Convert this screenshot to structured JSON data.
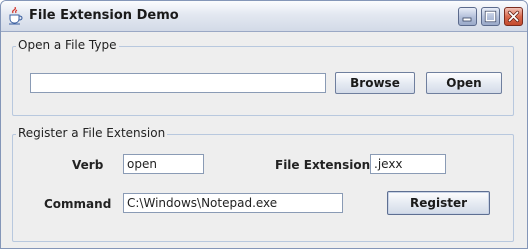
{
  "window": {
    "title": "File Extension Demo",
    "icon": "java-cup-icon",
    "controls": [
      "minimize-icon",
      "maximize-icon",
      "close-icon"
    ]
  },
  "open_group": {
    "title": "Open a File Type",
    "path_value": "",
    "browse_label": "Browse",
    "open_label": "Open"
  },
  "register_group": {
    "title": "Register a File Extension",
    "verb_label": "Verb",
    "verb_value": "open",
    "extension_label": "File Extension",
    "extension_value": ".jexx",
    "command_label": "Command",
    "command_value": "C:\\Windows\\Notepad.exe",
    "register_label": "Register"
  },
  "colors": {
    "window_bg": "#eeeeee",
    "group_border": "#b8c8de",
    "close_button": "#c44a2d"
  }
}
